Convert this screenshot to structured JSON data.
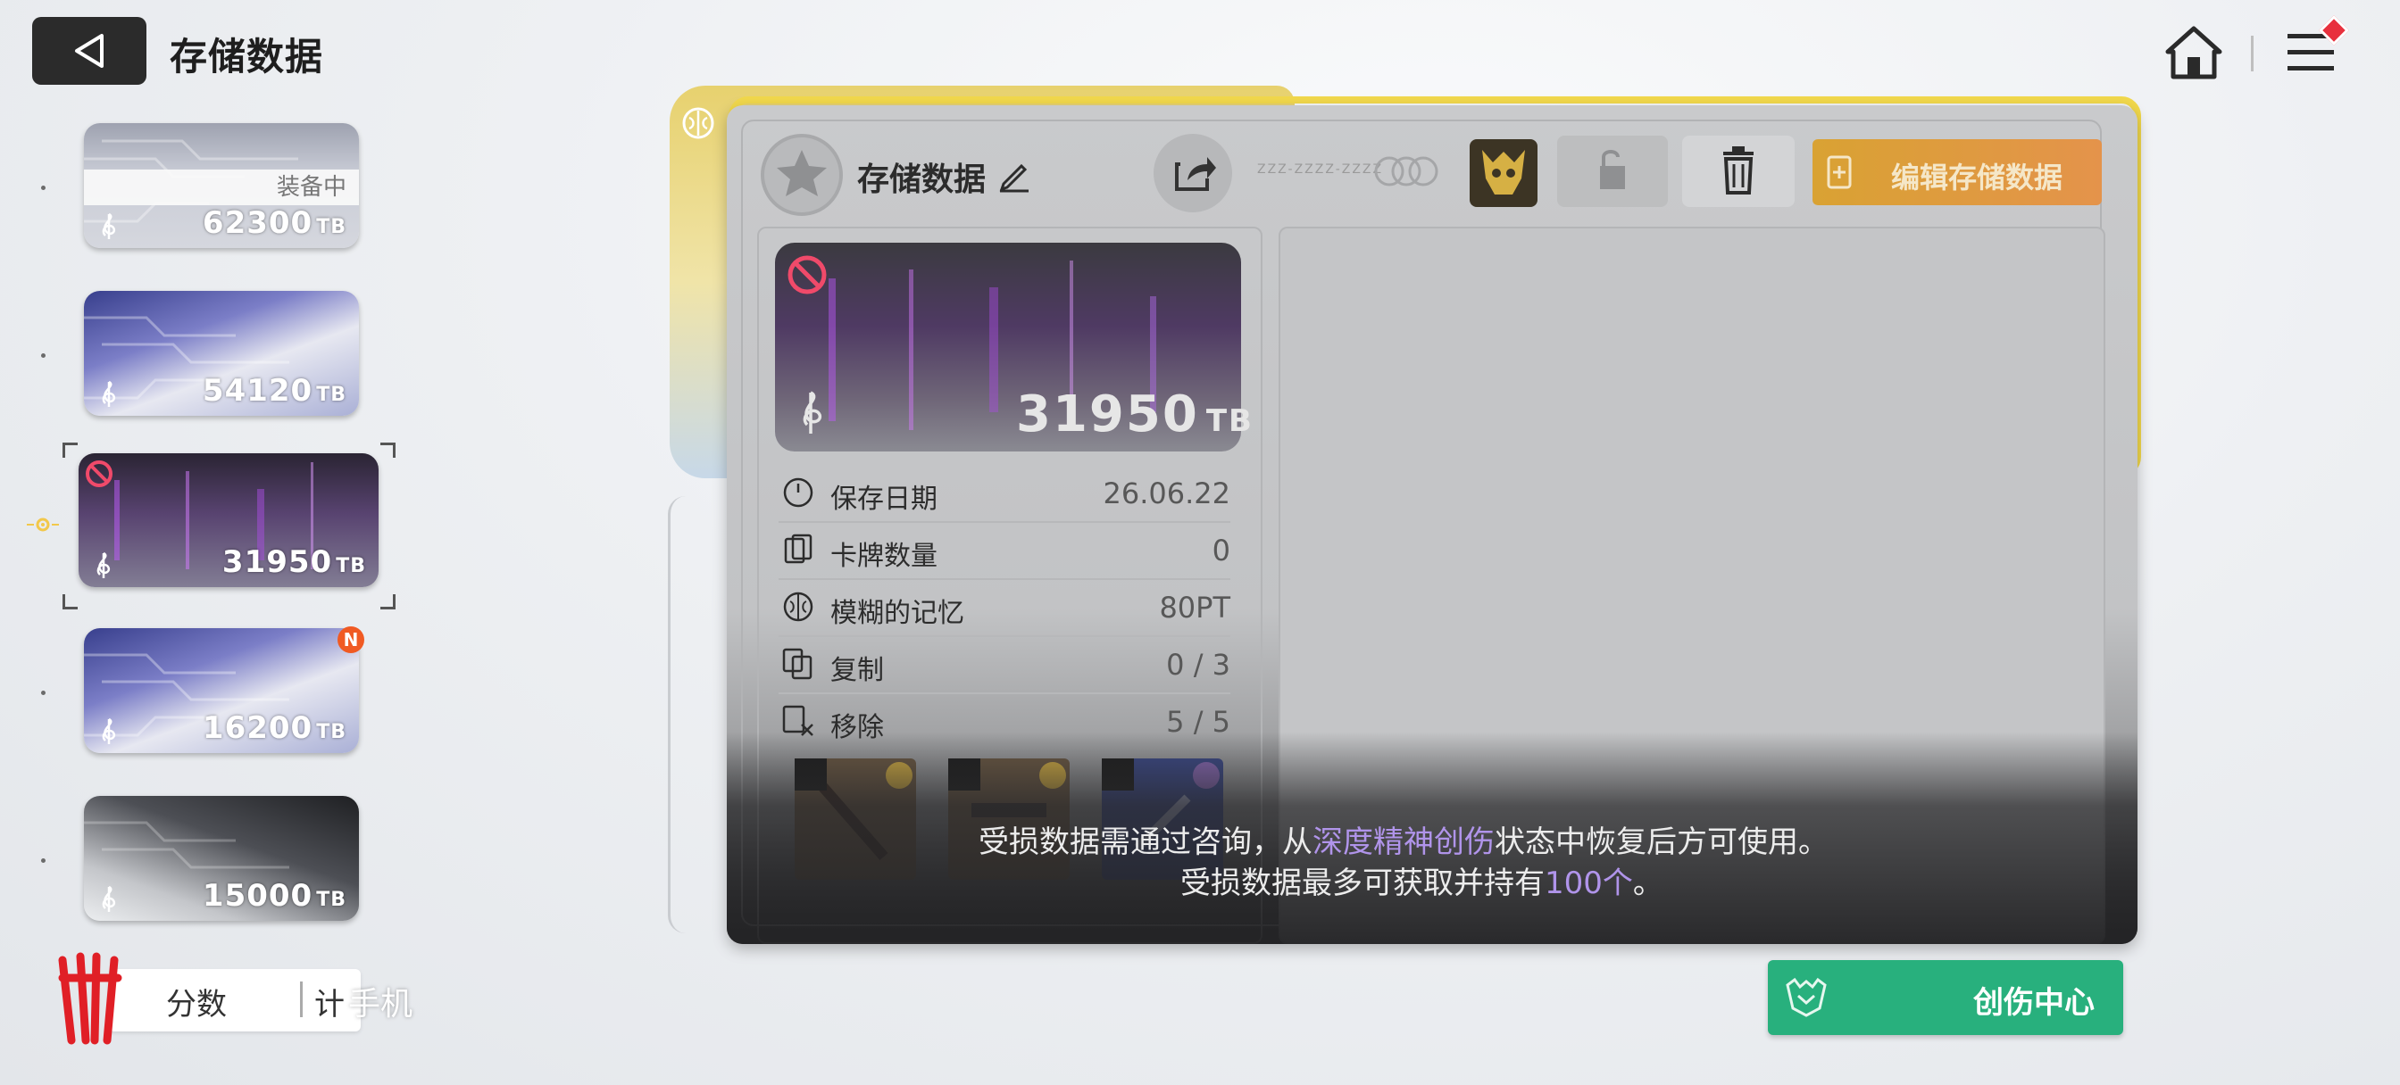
{
  "header": {
    "title": "存储数据",
    "back_label": "back"
  },
  "cards": [
    {
      "value": "62300",
      "unit": "TB",
      "equip_label": "装备中"
    },
    {
      "value": "54120",
      "unit": "TB"
    },
    {
      "value": "31950",
      "unit": "TB"
    },
    {
      "value": "16200",
      "unit": "TB",
      "badge": "N"
    },
    {
      "value": "15000",
      "unit": "TB"
    }
  ],
  "bottom_left": {
    "score_label": "分数",
    "score_frag": "计",
    "phone_text": "手机"
  },
  "panel": {
    "title": "存储数据",
    "dim_text": "ZZZ-ZZZZ-ZZZZ",
    "edit_button": "编辑存储数据",
    "card_value": "31950",
    "card_unit": "TB",
    "stats": [
      {
        "label": "保存日期",
        "value": "26.06.22",
        "icon": "clock-icon"
      },
      {
        "label": "卡牌数量",
        "value": "0",
        "icon": "cards-icon"
      },
      {
        "label": "模糊的记忆",
        "value": "80PT",
        "icon": "brain-icon"
      },
      {
        "label": "复制",
        "value": "0 / 3",
        "icon": "copy-icon"
      },
      {
        "label": "移除",
        "value": "5 / 5",
        "icon": "remove-icon"
      }
    ]
  },
  "notice": {
    "line1_pre": "受损数据需通过咨询，从",
    "line1_hl": "深度精神创伤",
    "line1_post": "状态中恢复后方可使用。",
    "line2_pre": "受损数据最多可获取并持有",
    "line2_hl": "100个",
    "line2_post": "。"
  },
  "footer": {
    "center_button": "创伤中心"
  },
  "colors": {
    "accent_yellow": "#f1d84c",
    "edit_orange": "#e4934b",
    "center_green": "#28b07d",
    "highlight_purple": "#b094ea"
  }
}
